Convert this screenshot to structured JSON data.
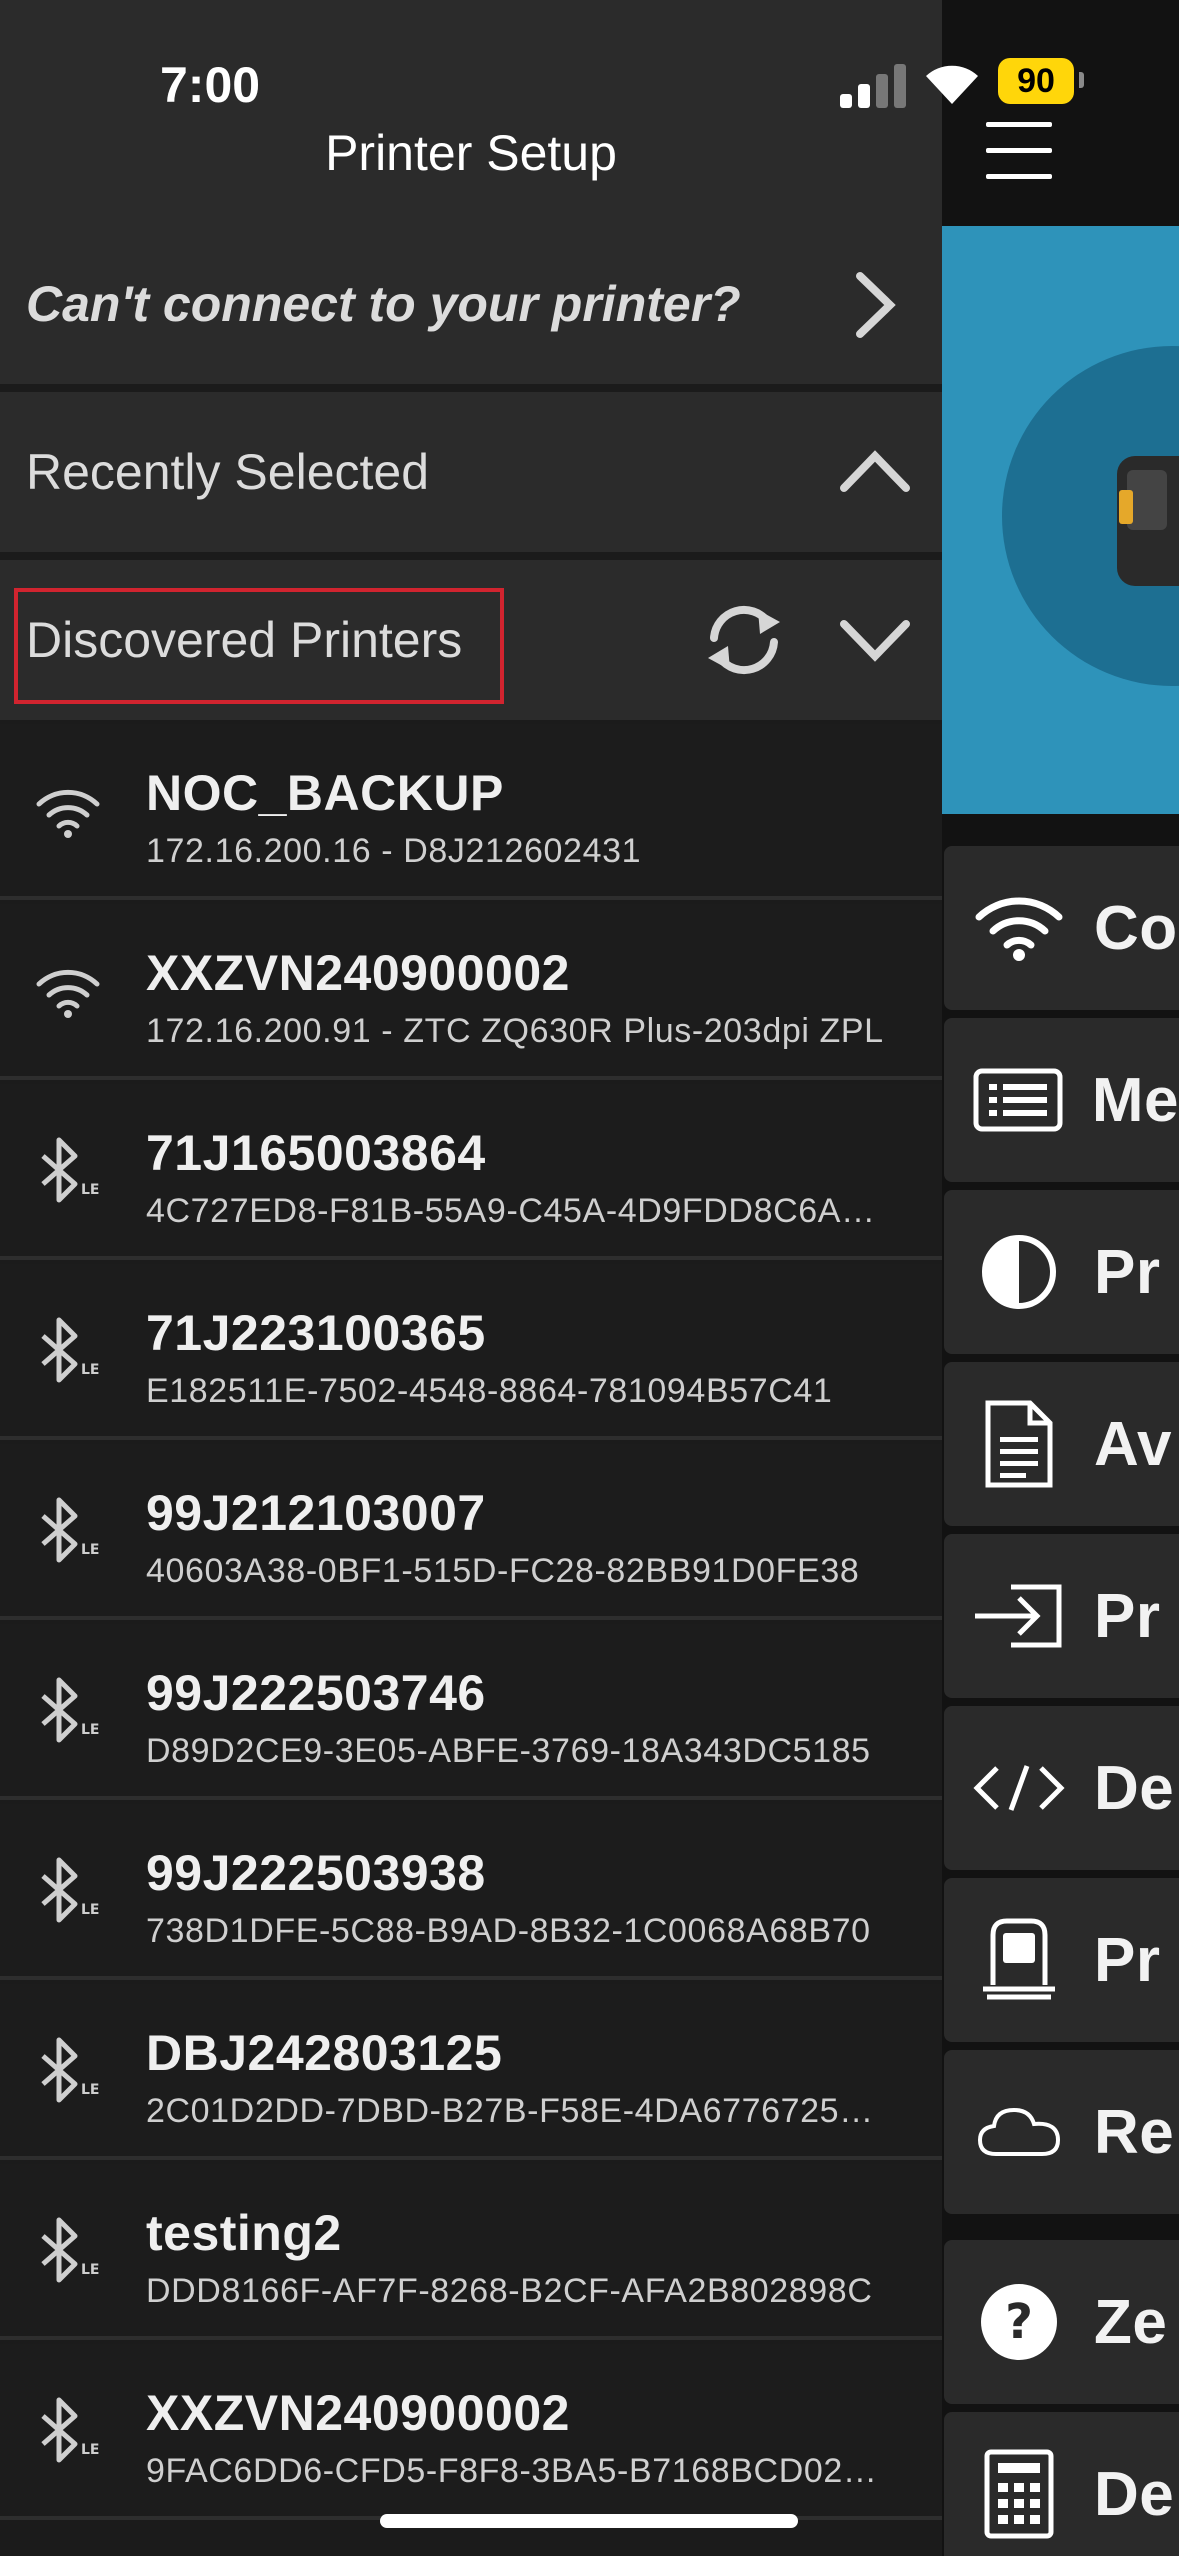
{
  "status_bar": {
    "time": "7:00",
    "battery": "90"
  },
  "header": {
    "title": "Printer Setup",
    "menu_icon": "hamburger-icon"
  },
  "sections": {
    "cant_connect": "Can't connect to your printer?",
    "recently_selected": "Recently Selected",
    "discovered_printers": "Discovered Printers"
  },
  "printers": [
    {
      "name": "NOC_BACKUP",
      "detail": "172.16.200.16 - D8J212602431",
      "icon": "wifi-icon"
    },
    {
      "name": "XXZVN240900002",
      "detail": "172.16.200.91 - ZTC ZQ630R Plus-203dpi ZPL",
      "icon": "wifi-icon"
    },
    {
      "name": "71J165003864",
      "detail": "4C727ED8-F81B-55A9-C45A-4D9FDD8C6A…",
      "icon": "bluetooth-le-icon"
    },
    {
      "name": "71J223100365",
      "detail": "E182511E-7502-4548-8864-781094B57C41",
      "icon": "bluetooth-le-icon"
    },
    {
      "name": "99J212103007",
      "detail": "40603A38-0BF1-515D-FC28-82BB91D0FE38",
      "icon": "bluetooth-le-icon"
    },
    {
      "name": "99J222503746",
      "detail": "D89D2CE9-3E05-ABFE-3769-18A343DC5185",
      "icon": "bluetooth-le-icon"
    },
    {
      "name": "99J222503938",
      "detail": "738D1DFE-5C88-B9AD-8B32-1C0068A68B70",
      "icon": "bluetooth-le-icon"
    },
    {
      "name": "DBJ242803125",
      "detail": "2C01D2DD-7DBD-B27B-F58E-4DA6776725…",
      "icon": "bluetooth-le-icon"
    },
    {
      "name": "testing2",
      "detail": "DDD8166F-AF7F-8268-B2CF-AFA2B802898C",
      "icon": "bluetooth-le-icon"
    },
    {
      "name": "XXZVN240900002",
      "detail": "9FAC6DD6-CFD5-F8F8-3BA5-B7168BCD02…",
      "icon": "bluetooth-le-icon"
    }
  ],
  "side_menu": [
    {
      "label": "Co",
      "icon": "wifi-icon"
    },
    {
      "label": "Me",
      "icon": "list-icon"
    },
    {
      "label": "Pr",
      "icon": "contrast-icon"
    },
    {
      "label": "Av",
      "icon": "document-icon"
    },
    {
      "label": "Pr",
      "icon": "sign-in-icon"
    },
    {
      "label": "De",
      "icon": "code-icon"
    },
    {
      "label": "Pr",
      "icon": "printer-icon"
    },
    {
      "label": "Re",
      "icon": "cloud-icon"
    },
    {
      "label": "Ze",
      "icon": "help-icon"
    },
    {
      "label": "De",
      "icon": "calculator-icon"
    }
  ],
  "colors": {
    "highlight": "#d1242f",
    "accent_blue": "#2e93ba",
    "battery": "#ffd60a"
  }
}
